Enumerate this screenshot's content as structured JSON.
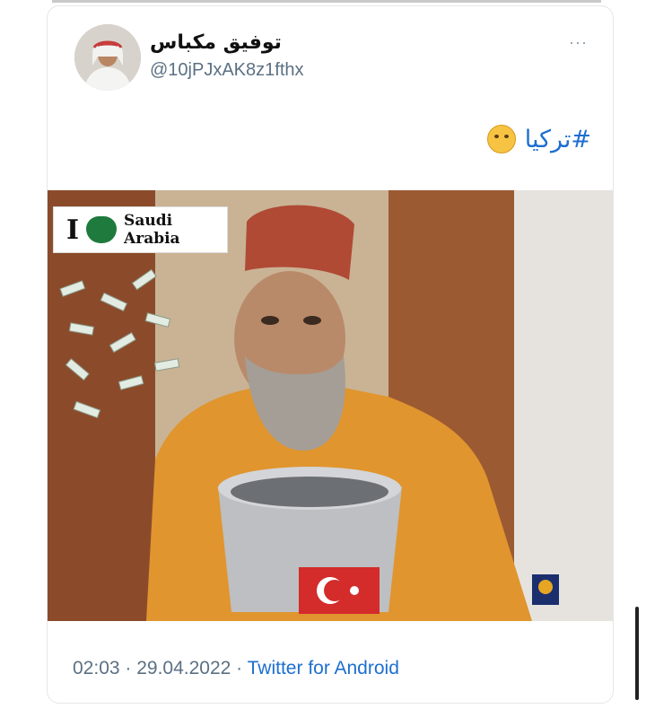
{
  "tweet": {
    "author_name": "توفيق مكباس",
    "author_handle": "@10jPJxAK8z1fthx",
    "more_label": "···",
    "text": "#تركيا",
    "emoji": "shushing-face",
    "timestamp_time": "02:03",
    "timestamp_date": "29.04.2022",
    "separator": " · ",
    "source": "Twitter for Android"
  },
  "media": {
    "sign_letter": "I",
    "sign_line1": "Saudi",
    "sign_line2": "Arabia"
  },
  "colors": {
    "link": "#1d6fd0",
    "secondary_text": "#5b7083",
    "fez": "#b04a35",
    "shirt": "#e0952e"
  }
}
